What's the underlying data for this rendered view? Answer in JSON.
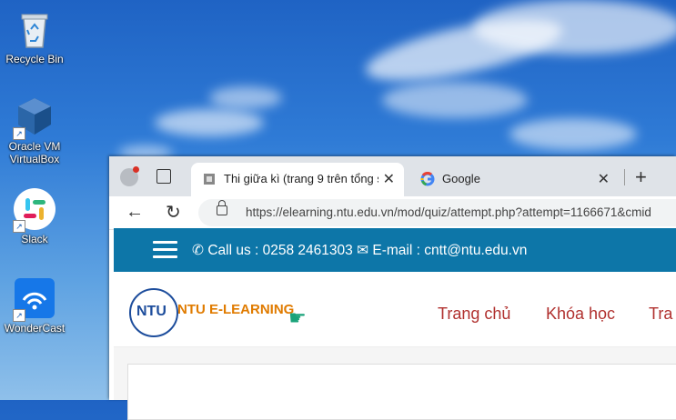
{
  "desktop": {
    "icons": [
      {
        "label": "Recycle Bin",
        "icon": "recycle-bin-icon"
      },
      {
        "label": "Oracle VM VirtualBox",
        "icon": "virtualbox-icon"
      },
      {
        "label": "Slack",
        "icon": "slack-icon"
      },
      {
        "label": "WonderCast",
        "icon": "wondercast-icon"
      }
    ]
  },
  "browser": {
    "tabs": [
      {
        "title": "Thi giữa kì (trang 9 trên tổng số",
        "active": true
      },
      {
        "title": "Google",
        "active": false
      }
    ],
    "url": "https://elearning.ntu.edu.vn/mod/quiz/attempt.php?attempt=1166671&cmid"
  },
  "site": {
    "contact_call": "Call us : 0258 2461303",
    "contact_email": "E-mail : cntt@ntu.edu.vn",
    "logo_text": "NTU",
    "brand": "NTU E-LEARNING",
    "nav": [
      "Trang chủ",
      "Khóa học",
      "Tra"
    ]
  },
  "colors": {
    "topbar": "#0d76a8",
    "nav_link": "#b0302e",
    "brand": "#e07b00"
  }
}
